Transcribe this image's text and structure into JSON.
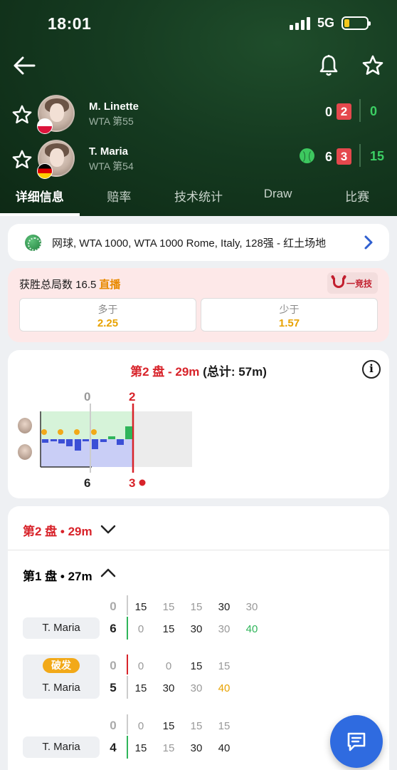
{
  "status": {
    "time": "18:01",
    "network": "5G"
  },
  "match": {
    "players": [
      {
        "name": "M. Linette",
        "rank": "WTA 第55",
        "sets": "0",
        "game": "2",
        "points": "0"
      },
      {
        "name": "T. Maria",
        "rank": "WTA 第54",
        "sets": "6",
        "game": "3",
        "points": "15"
      }
    ]
  },
  "tabs": [
    "详细信息",
    "赔率",
    "技术统计",
    "Draw",
    "比赛"
  ],
  "tournament": {
    "text": "网球, WTA 1000, WTA 1000 Rome, Italy, 128强 - 红土场地"
  },
  "odds": {
    "title": "获胜总局数 16.5",
    "live": "直播",
    "brand": "一竞技",
    "over": {
      "label": "多于",
      "value": "2.25"
    },
    "under": {
      "label": "少于",
      "value": "1.57"
    }
  },
  "timeline": {
    "set_label": "第2 盘 - 29m",
    "total": "(总计: 57m)",
    "set1_top": "0",
    "set1_bottom": "6",
    "set2_top": "2",
    "set2_bottom": "3"
  },
  "sets": {
    "set2_header": "第2 盘 • 29m",
    "set1_header": "第1 盘 • 27m",
    "break_label": "破发",
    "games": [
      {
        "player": "T. Maria",
        "top": "0",
        "bottom": "6",
        "top_pts": [
          "15",
          "15",
          "15",
          "30",
          "30"
        ],
        "bottom_pts": [
          "0",
          "15",
          "30",
          "30",
          "40"
        ],
        "bar_color": "#2fb55a",
        "break": false
      },
      {
        "player": "T. Maria",
        "top": "0",
        "bottom": "5",
        "top_pts": [
          "0",
          "0",
          "15",
          "15"
        ],
        "bottom_pts": [
          "15",
          "30",
          "30",
          "40"
        ],
        "bar_color": "#d8232a",
        "break": true
      },
      {
        "player": "T. Maria",
        "top": "0",
        "bottom": "4",
        "top_pts": [
          "0",
          "15",
          "15",
          "15"
        ],
        "bottom_pts": [
          "15",
          "15",
          "30",
          "40"
        ],
        "bar_color": "#2fb55a",
        "break": false
      }
    ]
  },
  "colors": {
    "accent_red": "#d8232a",
    "win_green": "#2fb55a",
    "odds_yellow": "#e8a200",
    "fab_blue": "#2f6be0"
  }
}
